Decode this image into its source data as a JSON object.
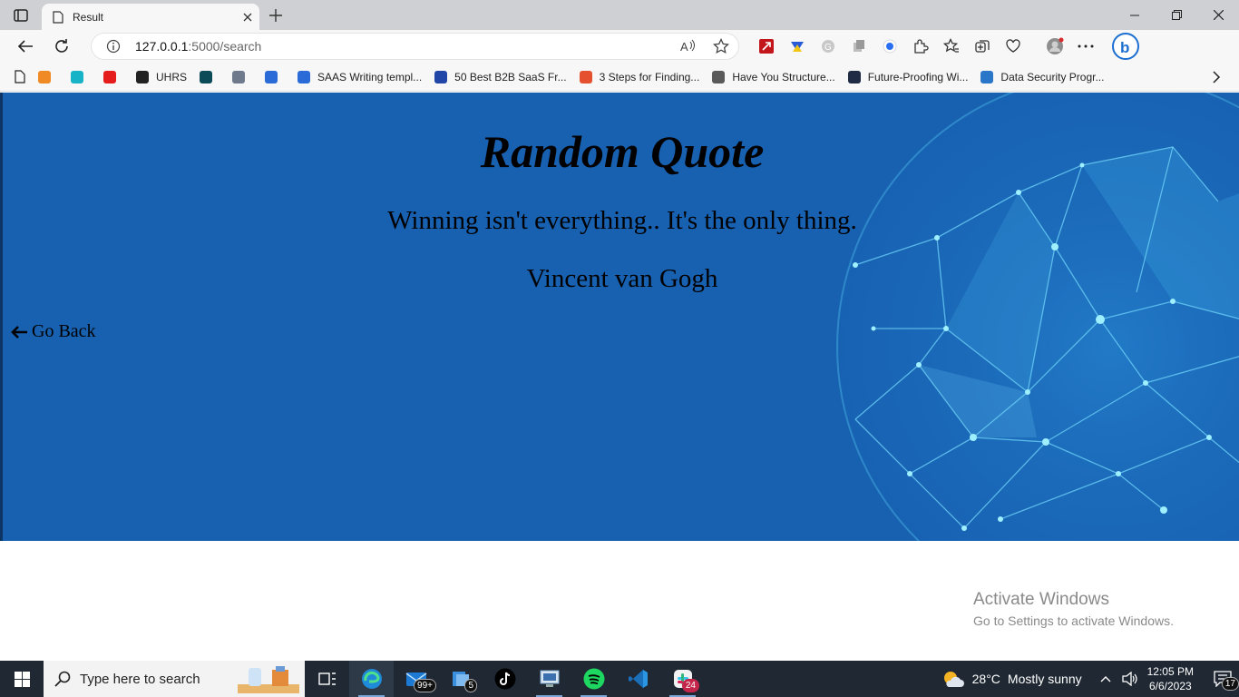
{
  "browser": {
    "tab_title": "Result",
    "url_host": "127.0.0.1",
    "url_path": ":5000/search",
    "window_controls": [
      "minimize",
      "restore",
      "close"
    ]
  },
  "bookmarks": [
    {
      "label": "",
      "color": "#f08a24"
    },
    {
      "label": "",
      "color": "#18b3c7"
    },
    {
      "label": "",
      "color": "#e61d1d"
    },
    {
      "label": "UHRS",
      "color": "#222222"
    },
    {
      "label": "",
      "color": "#0a4b57"
    },
    {
      "label": "",
      "color": "#6f7b8c"
    },
    {
      "label": "",
      "color": "#2a6bd8"
    },
    {
      "label": "SAAS Writing templ...",
      "color": "#2a6bd8"
    },
    {
      "label": "50 Best B2B SaaS Fr...",
      "color": "#2246a8"
    },
    {
      "label": "3 Steps for Finding...",
      "color": "#e5512e"
    },
    {
      "label": "Have You Structure...",
      "color": "#5a5a5a"
    },
    {
      "label": "Future-Proofing Wi...",
      "color": "#1f2a44"
    },
    {
      "label": "Data Security Progr...",
      "color": "#2a77c9"
    }
  ],
  "page": {
    "title": "Random Quote",
    "quote": "Winning isn't everything.. It's the only thing.",
    "author": "Vincent van Gogh",
    "back_label": "Go Back",
    "background_color": "#1860b0"
  },
  "watermark": {
    "line1": "Activate Windows",
    "line2": "Go to Settings to activate Windows."
  },
  "taskbar": {
    "search_placeholder": "Type here to search",
    "mail_badge": "99+",
    "folder_badge": "5",
    "slack_badge": "24",
    "temperature": "28°C",
    "weather": "Mostly sunny",
    "time": "12:05 PM",
    "date": "6/6/2023",
    "notifications": "17"
  }
}
